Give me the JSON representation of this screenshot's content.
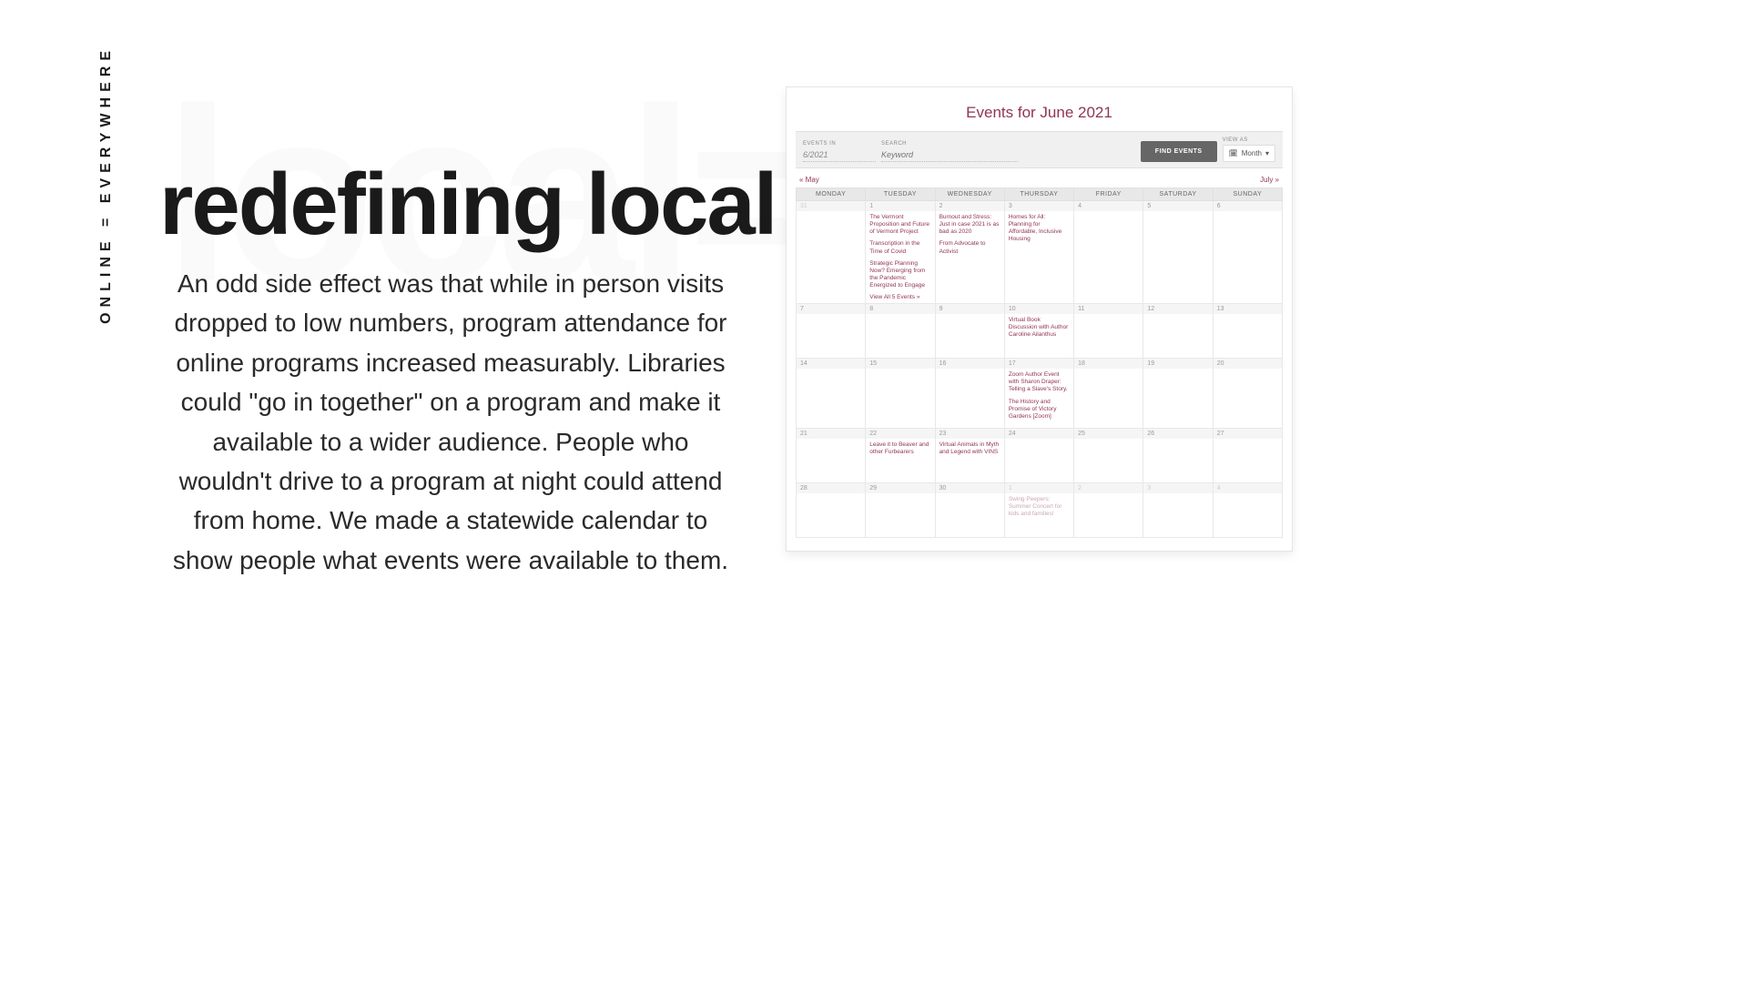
{
  "sidebar_label": "ONLINE = EVERYWHERE",
  "ghost": "local=Ve",
  "heading": "redefining local",
  "body": "An odd side effect was that while in person visits dropped to low numbers, program attendance for online programs increased measurably. Libraries could \"go in together\" on a program and make it available to a wider audience. People who wouldn't drive to a program at night could attend from home. We made a statewide calendar to show people what events were available to them.",
  "calendar": {
    "title": "Events for June 2021",
    "toolbar": {
      "events_in_label": "EVENTS IN",
      "events_in_value": "6/2021",
      "search_label": "SEARCH",
      "search_placeholder": "Keyword",
      "find_button": "FIND EVENTS",
      "view_as_label": "VIEW AS",
      "view_as_value": "Month"
    },
    "nav_prev": "« May",
    "nav_next": "July »",
    "days": [
      "MONDAY",
      "TUESDAY",
      "WEDNESDAY",
      "THURSDAY",
      "FRIDAY",
      "SATURDAY",
      "SUNDAY"
    ],
    "weeks": [
      [
        {
          "num": "31",
          "mute": true,
          "events": []
        },
        {
          "num": "1",
          "events": [
            "The Vermont Proposition and Future of  Vermont Project",
            "Transcription in the Time of Covid",
            "Strategic Planning Now? Emerging from the Pandemic Energized to Engage"
          ],
          "view_all": "View All 5 Events »"
        },
        {
          "num": "2",
          "events": [
            "Burnout and Stress: Just in case 2021 is as bad as 2020",
            "From Advocate to Activist"
          ]
        },
        {
          "num": "3",
          "events": [
            "Homes for All: Planning for Affordable, Inclusive Housing"
          ]
        },
        {
          "num": "4",
          "events": []
        },
        {
          "num": "5",
          "events": []
        },
        {
          "num": "6",
          "events": []
        }
      ],
      [
        {
          "num": "7",
          "events": []
        },
        {
          "num": "8",
          "events": []
        },
        {
          "num": "9",
          "events": []
        },
        {
          "num": "10",
          "events": [
            "Virtual Book Discussion with Author Caroline Ailanthus"
          ]
        },
        {
          "num": "11",
          "events": []
        },
        {
          "num": "12",
          "events": []
        },
        {
          "num": "13",
          "events": []
        }
      ],
      [
        {
          "num": "14",
          "events": []
        },
        {
          "num": "15",
          "events": []
        },
        {
          "num": "16",
          "events": []
        },
        {
          "num": "17",
          "events": [
            "Zoom Author Event with Sharon Draper:  Telling a Slave's Story.",
            "The History and Promise of Victory Gardens [Zoom]"
          ]
        },
        {
          "num": "18",
          "events": []
        },
        {
          "num": "19",
          "events": []
        },
        {
          "num": "20",
          "events": []
        }
      ],
      [
        {
          "num": "21",
          "events": []
        },
        {
          "num": "22",
          "events": [
            "Leave it to Beaver and other Furbearers"
          ]
        },
        {
          "num": "23",
          "events": [
            "Virtual Animals in Myth and Legend with VINS"
          ]
        },
        {
          "num": "24",
          "events": []
        },
        {
          "num": "25",
          "events": []
        },
        {
          "num": "26",
          "events": []
        },
        {
          "num": "27",
          "events": []
        }
      ],
      [
        {
          "num": "28",
          "events": []
        },
        {
          "num": "29",
          "events": []
        },
        {
          "num": "30",
          "events": []
        },
        {
          "num": "1",
          "mute": true,
          "events": [
            {
              "text": "Swing Peepers: Summer Concert for kids and families!",
              "mute": true
            }
          ]
        },
        {
          "num": "2",
          "mute": true,
          "events": []
        },
        {
          "num": "3",
          "mute": true,
          "events": []
        },
        {
          "num": "4",
          "mute": true,
          "events": []
        }
      ]
    ]
  }
}
